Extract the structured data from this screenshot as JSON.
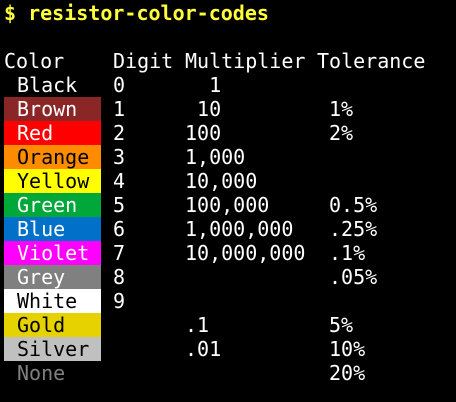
{
  "command": "$ resistor-color-codes",
  "headers": {
    "color": "Color",
    "digit": "Digit",
    "multiplier": "Multiplier",
    "tolerance": "Tolerance"
  },
  "rows": [
    {
      "name": "Black",
      "bg": "#000000",
      "fg": "#ffffff",
      "digit": "0",
      "multiplier": "  1",
      "tolerance": ""
    },
    {
      "name": "Brown",
      "bg": "#8b2626",
      "fg": "#ffffff",
      "digit": "1",
      "multiplier": " 10",
      "tolerance": "1%"
    },
    {
      "name": "Red",
      "bg": "#ff0000",
      "fg": "#ffffff",
      "digit": "2",
      "multiplier": "100",
      "tolerance": "2%"
    },
    {
      "name": "Orange",
      "bg": "#ff8c00",
      "fg": "#000000",
      "digit": "3",
      "multiplier": "1,000",
      "tolerance": ""
    },
    {
      "name": "Yellow",
      "bg": "#ffff00",
      "fg": "#000000",
      "digit": "4",
      "multiplier": "10,000",
      "tolerance": ""
    },
    {
      "name": "Green",
      "bg": "#00a83a",
      "fg": "#ffffff",
      "digit": "5",
      "multiplier": "100,000",
      "tolerance": "0.5%"
    },
    {
      "name": "Blue",
      "bg": "#0070c8",
      "fg": "#ffffff",
      "digit": "6",
      "multiplier": "1,000,000",
      "tolerance": ".25%"
    },
    {
      "name": "Violet",
      "bg": "#ff00ff",
      "fg": "#ffffff",
      "digit": "7",
      "multiplier": "10,000,000",
      "tolerance": ".1%"
    },
    {
      "name": "Grey",
      "bg": "#808080",
      "fg": "#ffffff",
      "digit": "8",
      "multiplier": "",
      "tolerance": ".05%"
    },
    {
      "name": "White",
      "bg": "#ffffff",
      "fg": "#000000",
      "digit": "9",
      "multiplier": "",
      "tolerance": ""
    },
    {
      "name": "Gold",
      "bg": "#e6d200",
      "fg": "#000000",
      "digit": "",
      "multiplier": ".1",
      "tolerance": "5%"
    },
    {
      "name": "Silver",
      "bg": "#c0c0c0",
      "fg": "#000000",
      "digit": "",
      "multiplier": ".01",
      "tolerance": "10%"
    },
    {
      "name": "None",
      "bg": "#000000",
      "fg": "#808080",
      "digit": "",
      "multiplier": "",
      "tolerance": "20%"
    }
  ]
}
